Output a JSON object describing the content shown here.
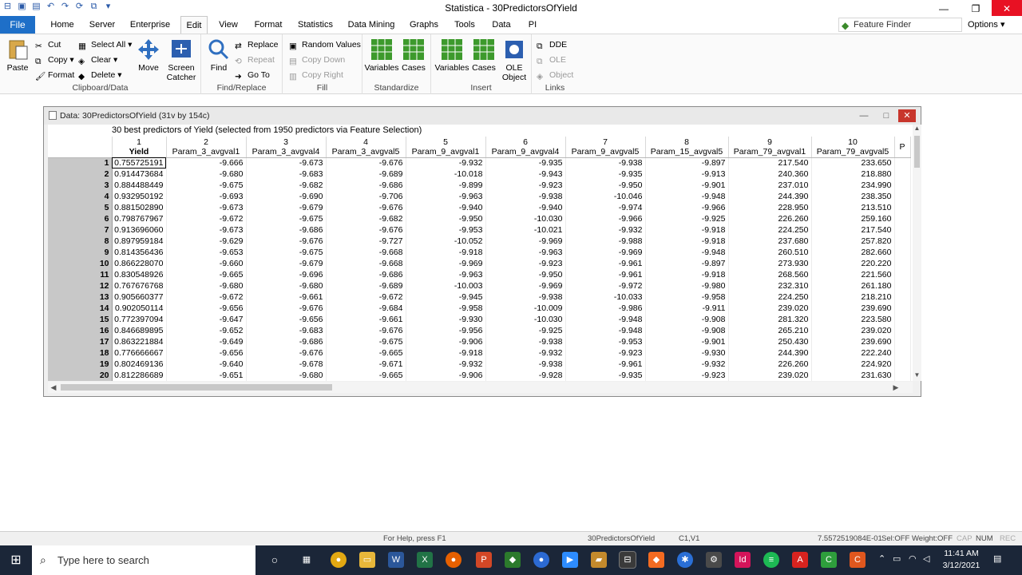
{
  "window": {
    "title": "Statistica - 30PredictorsOfYield",
    "qat_icons": [
      "statistica-icon",
      "save-icon",
      "open-icon",
      "undo-icon",
      "redo-icon",
      "refresh-icon",
      "copy-icon",
      "customize-icon"
    ]
  },
  "tabs": {
    "file": "File",
    "items": [
      "Home",
      "Server",
      "Enterprise",
      "Edit",
      "View",
      "Format",
      "Statistics",
      "Data Mining",
      "Graphs",
      "Tools",
      "Data",
      "PI"
    ],
    "active": "Edit",
    "feature_finder": "Feature Finder",
    "options": "Options"
  },
  "ribbon": {
    "clipboard": {
      "label": "Clipboard/Data",
      "paste": "Paste",
      "cut": "Cut",
      "copy": "Copy",
      "format": "Format",
      "select_all": "Select All",
      "clear": "Clear",
      "delete": "Delete",
      "move": "Move",
      "screen_catcher": "Screen Catcher"
    },
    "find_replace": {
      "label": "Find/Replace",
      "find": "Find",
      "replace": "Replace",
      "repeat": "Repeat",
      "go_to": "Go To"
    },
    "fill": {
      "label": "Fill",
      "random_values": "Random Values",
      "copy_down": "Copy Down",
      "copy_right": "Copy Right"
    },
    "standardize": {
      "label": "Standardize",
      "variables": "Variables",
      "cases": "Cases"
    },
    "insert": {
      "label": "Insert",
      "variables": "Variables",
      "cases": "Cases",
      "ole_object": "OLE Object"
    },
    "links": {
      "label": "Links",
      "dde": "DDE",
      "ole": "OLE",
      "object": "Object"
    }
  },
  "datawindow": {
    "title": "Data: 30PredictorsOfYield (31v by 154c)",
    "description": "30 best predictors of Yield (selected from 1950 predictors via Feature Selection)",
    "columns": [
      {
        "num": "1",
        "name": "Yield"
      },
      {
        "num": "2",
        "name": "Param_3_avgval1"
      },
      {
        "num": "3",
        "name": "Param_3_avgval4"
      },
      {
        "num": "4",
        "name": "Param_3_avgval5"
      },
      {
        "num": "5",
        "name": "Param_9_avgval1"
      },
      {
        "num": "6",
        "name": "Param_9_avgval4"
      },
      {
        "num": "7",
        "name": "Param_9_avgval5"
      },
      {
        "num": "8",
        "name": "Param_15_avgval5"
      },
      {
        "num": "9",
        "name": "Param_79_avgval1"
      },
      {
        "num": "10",
        "name": "Param_79_avgval5"
      },
      {
        "num": "",
        "name": "P"
      }
    ],
    "rows": [
      {
        "n": "1",
        "v": [
          "0.755725191",
          "-9.666",
          "-9.673",
          "-9.676",
          "-9.932",
          "-9.935",
          "-9.938",
          "-9.897",
          "217.540",
          "233.650"
        ]
      },
      {
        "n": "2",
        "v": [
          "0.914473684",
          "-9.680",
          "-9.683",
          "-9.689",
          "-10.018",
          "-9.943",
          "-9.935",
          "-9.913",
          "240.360",
          "218.880"
        ]
      },
      {
        "n": "3",
        "v": [
          "0.884488449",
          "-9.675",
          "-9.682",
          "-9.686",
          "-9.899",
          "-9.923",
          "-9.950",
          "-9.901",
          "237.010",
          "234.990"
        ]
      },
      {
        "n": "4",
        "v": [
          "0.932950192",
          "-9.693",
          "-9.690",
          "-9.706",
          "-9.963",
          "-9.938",
          "-10.046",
          "-9.948",
          "244.390",
          "238.350"
        ]
      },
      {
        "n": "5",
        "v": [
          "0.881502890",
          "-9.673",
          "-9.679",
          "-9.676",
          "-9.940",
          "-9.940",
          "-9.974",
          "-9.966",
          "228.950",
          "213.510"
        ]
      },
      {
        "n": "6",
        "v": [
          "0.798767967",
          "-9.672",
          "-9.675",
          "-9.682",
          "-9.950",
          "-10.030",
          "-9.966",
          "-9.925",
          "226.260",
          "259.160"
        ]
      },
      {
        "n": "7",
        "v": [
          "0.913696060",
          "-9.673",
          "-9.686",
          "-9.676",
          "-9.953",
          "-10.021",
          "-9.932",
          "-9.918",
          "224.250",
          "217.540"
        ]
      },
      {
        "n": "8",
        "v": [
          "0.897959184",
          "-9.629",
          "-9.676",
          "-9.727",
          "-10.052",
          "-9.969",
          "-9.988",
          "-9.918",
          "237.680",
          "257.820"
        ]
      },
      {
        "n": "9",
        "v": [
          "0.814356436",
          "-9.653",
          "-9.675",
          "-9.668",
          "-9.918",
          "-9.963",
          "-9.969",
          "-9.948",
          "260.510",
          "282.660"
        ]
      },
      {
        "n": "10",
        "v": [
          "0.866228070",
          "-9.660",
          "-9.679",
          "-9.668",
          "-9.969",
          "-9.923",
          "-9.961",
          "-9.897",
          "273.930",
          "220.220"
        ]
      },
      {
        "n": "11",
        "v": [
          "0.830548926",
          "-9.665",
          "-9.696",
          "-9.686",
          "-9.963",
          "-9.950",
          "-9.961",
          "-9.918",
          "268.560",
          "221.560"
        ]
      },
      {
        "n": "12",
        "v": [
          "0.767676768",
          "-9.680",
          "-9.680",
          "-9.689",
          "-10.003",
          "-9.969",
          "-9.972",
          "-9.980",
          "232.310",
          "261.180"
        ]
      },
      {
        "n": "13",
        "v": [
          "0.905660377",
          "-9.672",
          "-9.661",
          "-9.672",
          "-9.945",
          "-9.938",
          "-10.033",
          "-9.958",
          "224.250",
          "218.210"
        ]
      },
      {
        "n": "14",
        "v": [
          "0.902050114",
          "-9.656",
          "-9.676",
          "-9.684",
          "-9.958",
          "-10.009",
          "-9.986",
          "-9.911",
          "239.020",
          "239.690"
        ]
      },
      {
        "n": "15",
        "v": [
          "0.772397094",
          "-9.647",
          "-9.656",
          "-9.661",
          "-9.930",
          "-10.030",
          "-9.948",
          "-9.908",
          "281.320",
          "223.580"
        ]
      },
      {
        "n": "16",
        "v": [
          "0.846689895",
          "-9.652",
          "-9.683",
          "-9.676",
          "-9.956",
          "-9.925",
          "-9.948",
          "-9.908",
          "265.210",
          "239.020"
        ]
      },
      {
        "n": "17",
        "v": [
          "0.863221884",
          "-9.649",
          "-9.686",
          "-9.675",
          "-9.906",
          "-9.938",
          "-9.953",
          "-9.901",
          "250.430",
          "239.690"
        ]
      },
      {
        "n": "18",
        "v": [
          "0.776666667",
          "-9.656",
          "-9.676",
          "-9.665",
          "-9.918",
          "-9.932",
          "-9.923",
          "-9.930",
          "244.390",
          "222.240"
        ]
      },
      {
        "n": "19",
        "v": [
          "0.802469136",
          "-9.640",
          "-9.678",
          "-9.671",
          "-9.932",
          "-9.938",
          "-9.961",
          "-9.932",
          "226.260",
          "224.920"
        ]
      },
      {
        "n": "20",
        "v": [
          "0.812286689",
          "-9.651",
          "-9.680",
          "-9.665",
          "-9.906",
          "-9.928",
          "-9.935",
          "-9.923",
          "239.020",
          "231.630"
        ]
      }
    ]
  },
  "statusbar": {
    "help": "For Help, press F1",
    "file": "30PredictorsOfYield",
    "cell": "C1,V1",
    "value": "7.5572519084E-01",
    "sel": "Sel:OFF",
    "weight": "Weight:OFF",
    "cap": "CAP",
    "num": "NUM",
    "rec": "REC"
  },
  "taskbar": {
    "search_placeholder": "Type here to search",
    "time": "11:41 AM",
    "date": "3/12/2021"
  }
}
